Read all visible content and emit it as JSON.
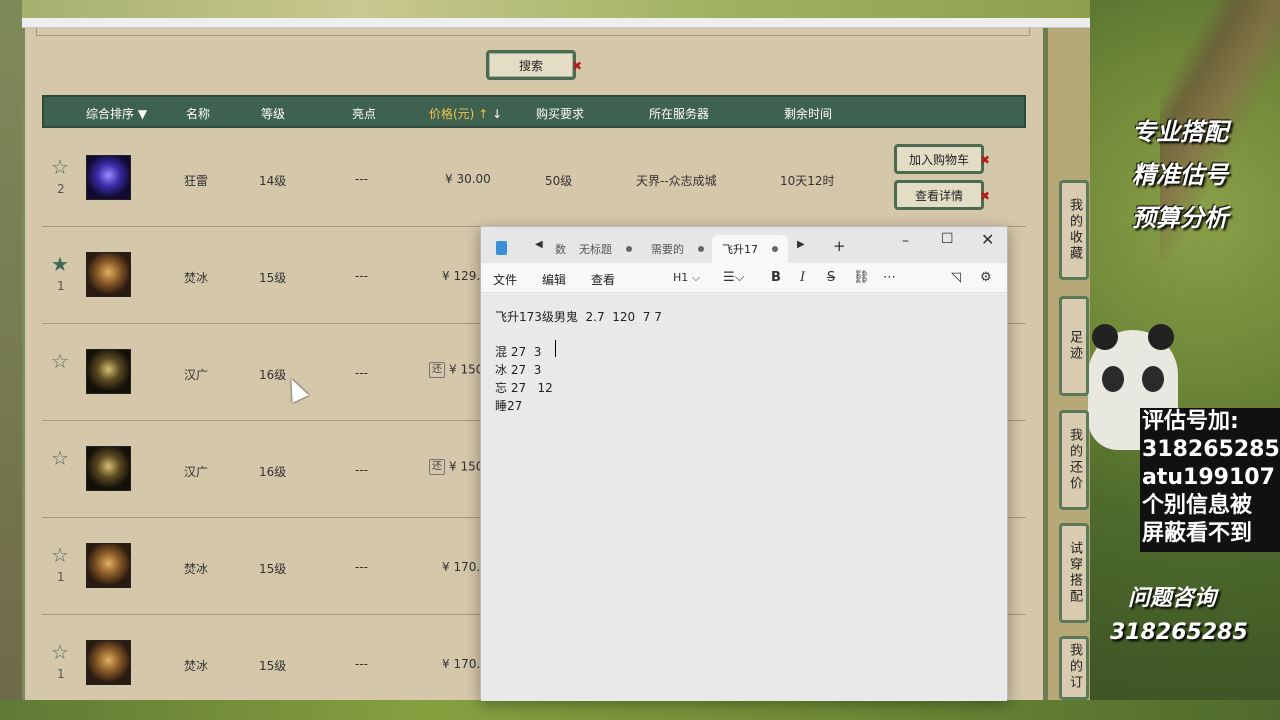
{
  "search": {
    "button_label": "搜索"
  },
  "table": {
    "headers": {
      "sort": "综合排序 ▼",
      "name": "名称",
      "level": "等级",
      "highlight": "亮点",
      "price": "价格(元)",
      "price_up": "↑",
      "price_down": "↓",
      "requirement": "购买要求",
      "server": "所在服务器",
      "time_left": "剩余时间"
    },
    "rows": [
      {
        "fav_icon": "star-outline",
        "fav_count": "2",
        "name": "狂雷",
        "level": "14级",
        "highlight": "---",
        "price": "¥ 30.00",
        "requirement": "50级",
        "server": "天界--众志成城",
        "time_left": "10天12时",
        "add_cart": "加入购物车",
        "details": "查看详情"
      },
      {
        "fav_icon": "star-filled",
        "fav_count": "1",
        "name": "焚冰",
        "level": "15级",
        "highlight": "---",
        "price": "¥ 129.0"
      },
      {
        "fav_icon": "star-outline",
        "fav_count": "",
        "name": "汉广",
        "level": "16级",
        "highlight": "---",
        "bargain": "还",
        "price": "¥ 150"
      },
      {
        "fav_icon": "star-outline",
        "fav_count": "",
        "name": "汉广",
        "level": "16级",
        "highlight": "---",
        "bargain": "还",
        "price": "¥ 150"
      },
      {
        "fav_icon": "star-outline",
        "fav_count": "1",
        "name": "焚冰",
        "level": "15级",
        "highlight": "---",
        "price": "¥ 170.0"
      },
      {
        "fav_icon": "star-outline",
        "fav_count": "1",
        "name": "焚冰",
        "level": "15级",
        "highlight": "---",
        "price": "¥ 170.8"
      }
    ]
  },
  "side_tabs": [
    "我的收藏",
    "足迹",
    "我的还价",
    "试穿搭配",
    "我的订"
  ],
  "promo": {
    "line1": "专业搭配",
    "line2": "精准估号",
    "line3": "预算分析"
  },
  "contact": {
    "line1": "评估号加:",
    "line2": "318265285",
    "line3": "atu199107",
    "line4": "个别信息被",
    "line5": "屏蔽看不到"
  },
  "consult": {
    "title": "问题咨询",
    "number": "318265285"
  },
  "notepad": {
    "tabs": {
      "t0": "数",
      "t1": "无标题",
      "t2": "需要的",
      "t3": "飞升17"
    },
    "menu": {
      "file": "文件",
      "edit": "编辑",
      "view": "查看"
    },
    "toolbar": {
      "heading": "H1"
    },
    "lines": [
      "飞升173级男鬼  2.7  120  7 7",
      "",
      "混 27  3",
      "冰 27  3",
      "忘 27   12",
      "睡27"
    ]
  },
  "colors": {
    "header_bg": "#3f6250",
    "page_bg": "#d5c7aa",
    "price_accent": "#f4c54a"
  }
}
